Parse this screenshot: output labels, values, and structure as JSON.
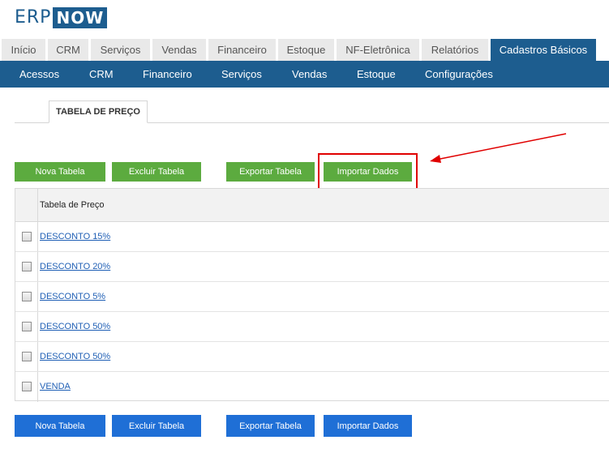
{
  "logo": {
    "part1": "ERP",
    "part2": "NOW"
  },
  "top_tabs": [
    {
      "label": "Início",
      "active": false
    },
    {
      "label": "CRM",
      "active": false
    },
    {
      "label": "Serviços",
      "active": false
    },
    {
      "label": "Vendas",
      "active": false
    },
    {
      "label": "Financeiro",
      "active": false
    },
    {
      "label": "Estoque",
      "active": false
    },
    {
      "label": "NF-Eletrônica",
      "active": false
    },
    {
      "label": "Relatórios",
      "active": false
    },
    {
      "label": "Cadastros Básicos",
      "active": true
    }
  ],
  "subnav": [
    "Acessos",
    "CRM",
    "Financeiro",
    "Serviços",
    "Vendas",
    "Estoque",
    "Configurações"
  ],
  "page_tab": "TABELA DE PREÇO",
  "actions": {
    "new": "Nova Tabela",
    "delete": "Excluir Tabela",
    "export": "Exportar Tabela",
    "import": "Importar Dados"
  },
  "table": {
    "header": "Tabela de Preço",
    "rows": [
      "DESCONTO 15%",
      "DESCONTO 20%",
      "DESCONTO 5%",
      "DESCONTO 50%",
      "DESCONTO 50%",
      "VENDA"
    ]
  },
  "colors": {
    "brand": "#1d5d8f",
    "green_button": "#5cab3f",
    "blue_button": "#1f6fd6",
    "highlight": "#e00000",
    "link": "#1f5fb5"
  }
}
